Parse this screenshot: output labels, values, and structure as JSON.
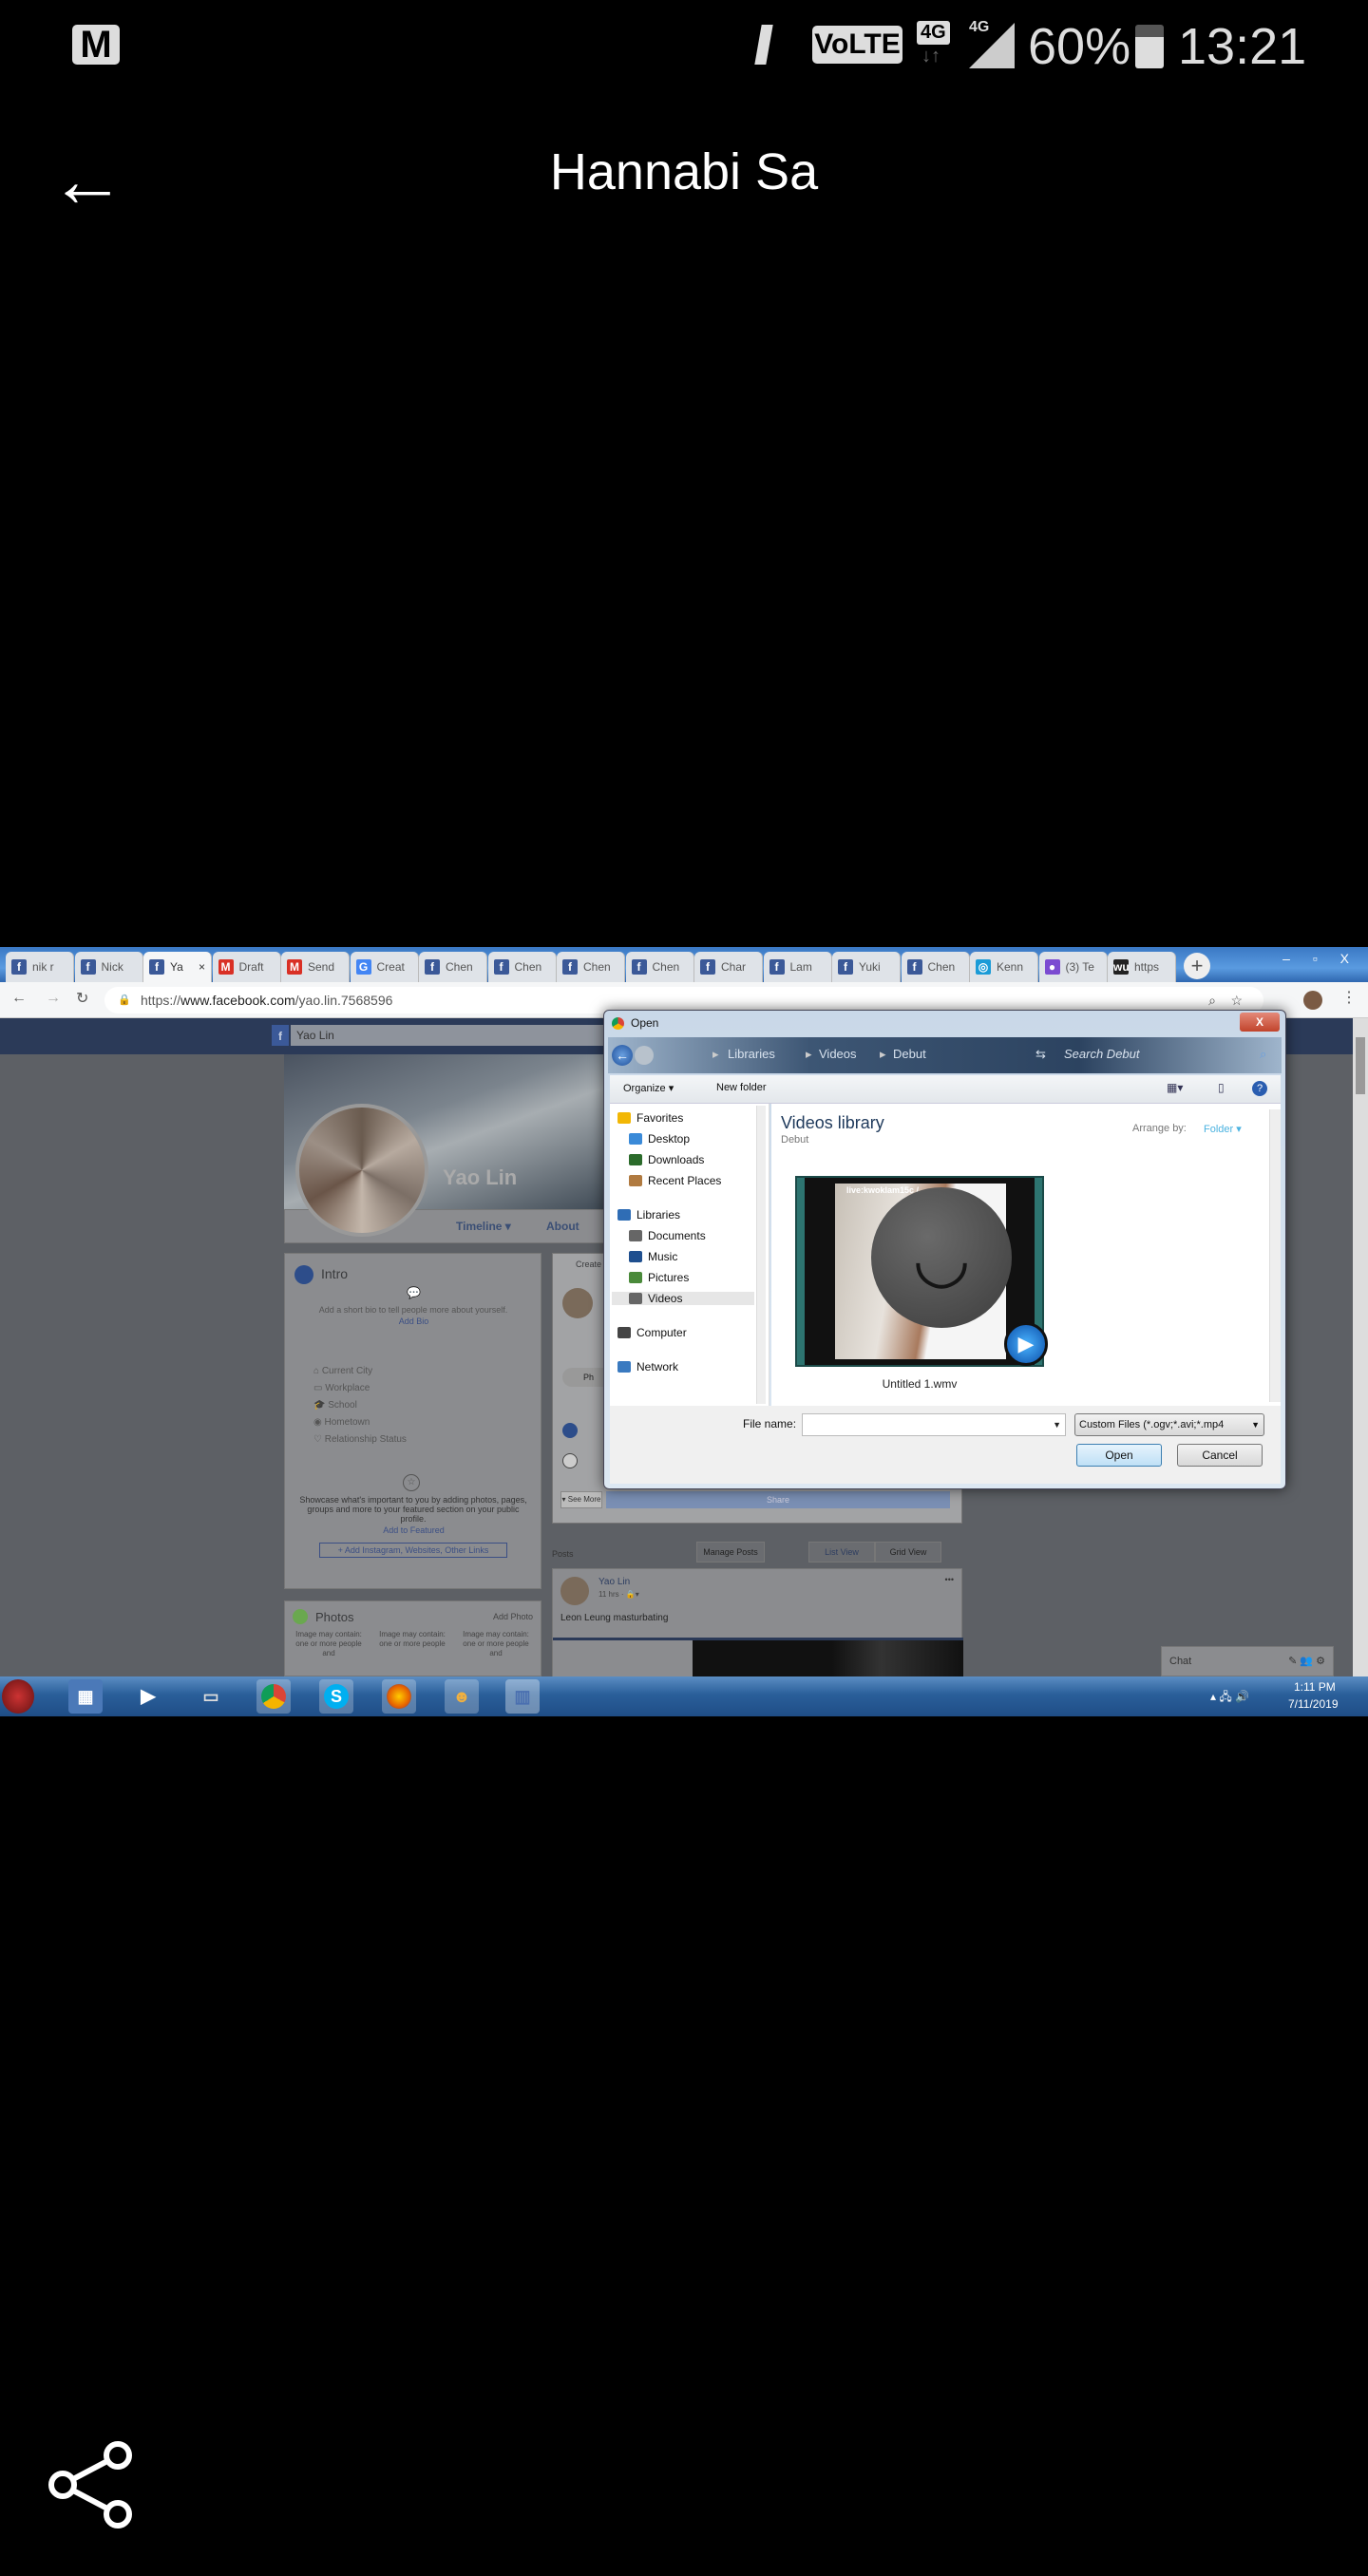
{
  "status_bar": {
    "left_icon": "gmail-icon",
    "network": "VoLTE",
    "net_badge": "4G",
    "signal_label": "4G",
    "battery": "60%",
    "time": "13:21",
    "icons": [
      "mute-icon",
      "volte-icon",
      "data-arrows-icon",
      "signal-icon",
      "battery-icon"
    ]
  },
  "header": {
    "title": "Hannabi Sa",
    "back_icon": "arrow-left-icon"
  },
  "footer": {
    "share_icon": "share-icon"
  },
  "screenshot": {
    "browser": {
      "tabs": [
        {
          "label": "nik r",
          "icon": "f",
          "color": "#3b5998"
        },
        {
          "label": "Nick",
          "icon": "f",
          "color": "#3b5998"
        },
        {
          "label": "Ya",
          "icon": "f",
          "color": "#3b5998",
          "active": true
        },
        {
          "label": "Draft",
          "icon": "M",
          "color": "#d93025"
        },
        {
          "label": "Send",
          "icon": "M",
          "color": "#d93025"
        },
        {
          "label": "Creat",
          "icon": "G",
          "color": "#4285f4"
        },
        {
          "label": "Chen",
          "icon": "f",
          "color": "#3b5998"
        },
        {
          "label": "Chen",
          "icon": "f",
          "color": "#3b5998"
        },
        {
          "label": "Chen",
          "icon": "f",
          "color": "#3b5998"
        },
        {
          "label": "Chen",
          "icon": "f",
          "color": "#3b5998"
        },
        {
          "label": "Char",
          "icon": "f",
          "color": "#3b5998"
        },
        {
          "label": "Lam",
          "icon": "f",
          "color": "#3b5998"
        },
        {
          "label": "Yuki",
          "icon": "f",
          "color": "#3b5998"
        },
        {
          "label": "Chen",
          "icon": "f",
          "color": "#3b5998"
        },
        {
          "label": "Kenn",
          "icon": "◎",
          "color": "#1a9bd7"
        },
        {
          "label": "(3) Te",
          "icon": "●",
          "color": "#7b4bd1"
        },
        {
          "label": "https",
          "icon": "wu",
          "color": "#222"
        }
      ],
      "new_tab": "+",
      "url_prefix": "https://",
      "url_host": "www.facebook.com",
      "url_path": "/yao.lin.7568596"
    },
    "facebook": {
      "search_value": "Yao Lin",
      "profile_name": "Yao Lin",
      "nav": {
        "timeline": "Timeline ▾",
        "about": "About"
      },
      "intro": {
        "title": "Intro",
        "bio_prompt": "Add a short bio to tell people more about yourself.",
        "add_bio": "Add Bio",
        "fields": [
          "Current City",
          "Workplace",
          "School",
          "Hometown",
          "Relationship Status"
        ],
        "featured_text": "Showcase what's important to you by adding photos, pages, groups and more to your featured section on your public profile.",
        "add_featured": "Add to Featured",
        "add_links": "+ Add Instagram, Websites, Other Links"
      },
      "photos": {
        "title": "Photos",
        "add_photo": "Add Photo",
        "alts": [
          "Image may contain: one or more people and",
          "Image may contain: one or more people",
          "Image may contain: one or more people and"
        ]
      },
      "create_post": {
        "title": "Create",
        "photo_label": "Ph",
        "see_more": "▾ See More",
        "share": "Share"
      },
      "posts": {
        "header": "Posts",
        "manage": "Manage Posts",
        "list_view": "List View",
        "grid_view": "Grid View"
      },
      "post": {
        "author": "Yao Lin",
        "time": "11 hrs · 🔒▾",
        "text": "Leon Leung masturbating",
        "menu": "•••"
      },
      "chat": "Chat"
    },
    "dialog": {
      "title": "Open",
      "breadcrumb": [
        "Libraries",
        "Videos",
        "Debut"
      ],
      "search_placeholder": "Search Debut",
      "toolbar": {
        "organize": "Organize ▾",
        "new_folder": "New folder"
      },
      "nav": [
        {
          "label": "Favorites",
          "level": 0,
          "color": "#f2b705"
        },
        {
          "label": "Desktop",
          "level": 1,
          "color": "#3a8ad8"
        },
        {
          "label": "Downloads",
          "level": 1,
          "color": "#2b6b2b"
        },
        {
          "label": "Recent Places",
          "level": 1,
          "color": "#b07a40"
        },
        {
          "label": "Libraries",
          "level": 0,
          "color": "#2f6db5",
          "gap": true
        },
        {
          "label": "Documents",
          "level": 1,
          "color": "#666"
        },
        {
          "label": "Music",
          "level": 1,
          "color": "#1f4f8f"
        },
        {
          "label": "Pictures",
          "level": 1,
          "color": "#4a8a3a"
        },
        {
          "label": "Videos",
          "level": 1,
          "color": "#666",
          "selected": true
        },
        {
          "label": "Computer",
          "level": 0,
          "color": "#444",
          "gap": true
        },
        {
          "label": "Network",
          "level": 0,
          "color": "#3a7ac0",
          "gap": true
        }
      ],
      "library_title": "Videos library",
      "library_sub": "Debut",
      "arrange_label": "Arrange by:",
      "arrange_value": "Folder ▾",
      "file": {
        "name": "Untitled 1.wmv",
        "overlay": "live:kwoklam15c / "
      },
      "file_name_label": "File name:",
      "file_name_value": "",
      "filter": "Custom Files (*.ogv;*.avi;*.mp4",
      "open": "Open",
      "cancel": "Cancel",
      "close": "X"
    },
    "taskbar": {
      "apps": [
        "start-orb",
        "explorer",
        "media-player",
        "display",
        "chrome",
        "skype",
        "firefox",
        "app-character",
        "save-app"
      ],
      "time": "1:11 PM",
      "date": "7/11/2019"
    }
  }
}
